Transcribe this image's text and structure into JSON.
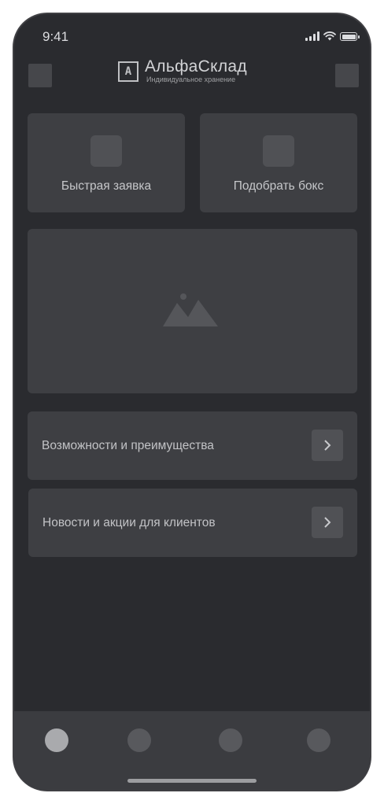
{
  "status_bar": {
    "time": "9:41"
  },
  "header": {
    "logo_mark": "A",
    "logo_title": "АльфаСклад",
    "logo_subtitle": "Индивидуальное хранение"
  },
  "quick_actions": [
    {
      "label": "Быстрая заявка"
    },
    {
      "label": "Подобрать бокс"
    }
  ],
  "banner": {
    "icon": "image-placeholder-icon"
  },
  "menu_rows": [
    {
      "label": "Возможности и преимущества"
    },
    {
      "label": "Новости и акции для клиентов"
    }
  ],
  "tab_bar": {
    "tab_count": 4,
    "active_index": 0
  },
  "colors": {
    "background": "#2a2b2f",
    "surface": "#3e3f43",
    "text": "#c2c3c6"
  }
}
